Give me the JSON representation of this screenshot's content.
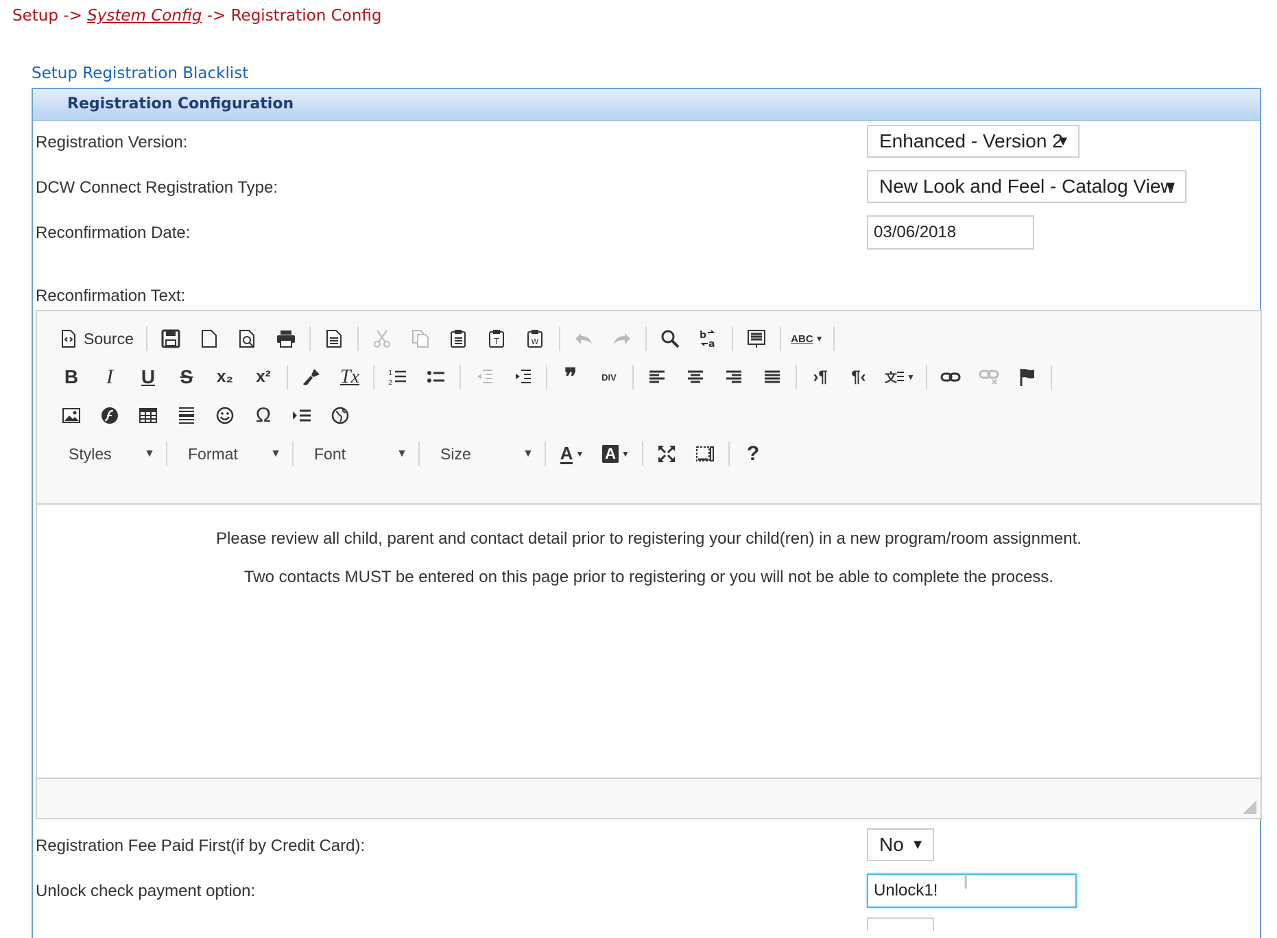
{
  "breadcrumb": {
    "setup": "Setup",
    "sep1": " -> ",
    "system_config": "System Config",
    "sep2": " -> ",
    "current": "Registration Config"
  },
  "blacklist_link": "Setup Registration Blacklist",
  "panel": {
    "title": "Registration Configuration"
  },
  "fields": {
    "registration_version": {
      "label": "Registration Version:",
      "value": "Enhanced - Version 2"
    },
    "connect_type": {
      "label": "DCW Connect Registration Type:",
      "value": "New Look and Feel - Catalog View"
    },
    "reconfirmation_date": {
      "label": "Reconfirmation Date:",
      "value": "03/06/2018"
    },
    "reconfirmation_text": {
      "label": "Reconfirmation Text:"
    },
    "fee_paid_first": {
      "label": "Registration Fee Paid First(if by Credit Card):",
      "value": "No"
    },
    "unlock_check": {
      "label": "Unlock check payment option:",
      "value": "Unlock1!"
    }
  },
  "editor": {
    "source_label": "Source",
    "styles_label": "Styles",
    "format_label": "Format",
    "font_label": "Font",
    "size_label": "Size",
    "glyphs": {
      "bold": "B",
      "italic": "I",
      "underline": "U",
      "strike": "S",
      "subscript": "x₂",
      "superscript": "x²",
      "remove_format": "Tx",
      "quote": "❞",
      "div": "DIV",
      "omega": "Ω",
      "help": "?",
      "spellcheck": "ABC",
      "text_color": "A",
      "bg_color": "A"
    },
    "content": {
      "line1": "Please review all child, parent and contact detail prior to registering your child(ren) in a new program/room assignment.",
      "line2": "Two contacts MUST be entered on this page prior to registering or you will not be able to complete the process."
    }
  },
  "colors": {
    "breadcrumb": "#b5121b",
    "link": "#1565c0",
    "panel_border": "#6aa0d8",
    "panel_title": "#1f3f73",
    "focus": "#4fb8e6"
  }
}
